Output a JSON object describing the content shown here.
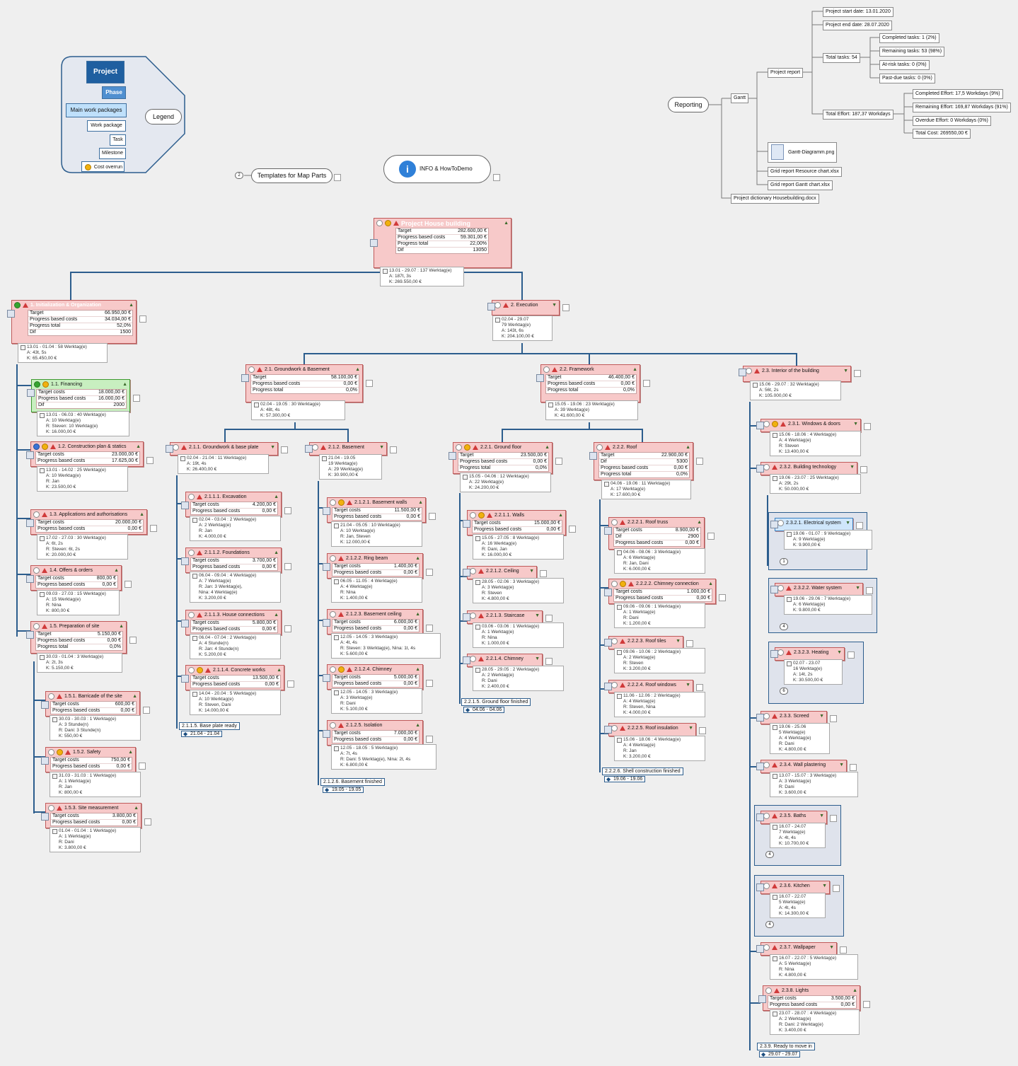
{
  "legend": {
    "title": "Legend",
    "items": [
      "Project",
      "Phase",
      "Main work packages",
      "Work package",
      "Task",
      "Milestone",
      "Cost overrun"
    ]
  },
  "templates": {
    "label": "Templates for Map Parts",
    "badge": "2"
  },
  "info": {
    "label": "INFO & HowToDemo"
  },
  "reporting": {
    "root": "Reporting",
    "gantt": "Gantt",
    "project_report": "Project report",
    "start": "Project start date: 13.01.2020",
    "end": "Project end date: 28.07.2020",
    "total_tasks": "Total tasks: 54",
    "completed": "Completed tasks: 1 (2%)",
    "remaining": "Remaining tasks: 53 (98%)",
    "at_risk": "At-risk tasks: 0 (0%)",
    "past_due": "Past-due tasks: 0 (0%)",
    "total_effort": "Total Effort: 187,37 Workdays",
    "completed_effort": "Completed Effort: 17,5 Workdays (9%)",
    "remaining_effort": "Remaining Effort: 169,87 Workdays (91%)",
    "overdue_effort": "Overdue Effort: 0 Workdays (0%)",
    "total_cost": "Total Cost: 269550,00 €",
    "gantt_png": "Gantt-Diagramm.png",
    "grid_resource": "Grid report Resource chart.xlsx",
    "grid_gantt": "Grid report Gantt chart.xlsx",
    "dictionary": "Project dictionary Housebuilding.docx"
  },
  "root": {
    "title": "Project House building",
    "rows": [
      [
        "Target",
        "282.600,00 €"
      ],
      [
        "Progress based costs",
        "59.301,00 €"
      ],
      [
        "Progress total",
        "22,00%"
      ],
      [
        "Dif",
        "13050"
      ]
    ],
    "info": [
      "13.01 - 29.07 : 137 Werktag(e)",
      "A: 187t, 3s",
      "K: 269.550,00 €"
    ]
  },
  "p1": {
    "title": "1. Initialization & Organization",
    "rows": [
      [
        "Target",
        "66.950,00 €"
      ],
      [
        "Progress based costs",
        "34.034,00 €"
      ],
      [
        "Progress total",
        "52,0%"
      ],
      [
        "Dif",
        "1500"
      ]
    ],
    "info": [
      "13.01 - 01.04 : 58 Werktag(e)",
      "A: 43t, 5s",
      "K: 65.450,00 €"
    ]
  },
  "p2": {
    "title": "2. Execution",
    "info": [
      "02.04 - 29.07",
      "79 Werktag(e)",
      "A: 143t, 6s",
      "K: 204.100,00 €"
    ]
  },
  "t11": {
    "title": "1.1. Financing",
    "rows": [
      [
        "Target costs",
        "18.000,00 €"
      ],
      [
        "Progress based costs",
        "16.000,00 €"
      ],
      [
        "Dif",
        "2000"
      ]
    ],
    "info": [
      "13.01 - 06.03 : 40 Werktag(e)",
      "A: 10 Werktag(e)",
      "R: Steven: 10 Werktag(e)",
      "K: 16.000,00 €"
    ]
  },
  "t12": {
    "title": "1.2. Construction plan & statics",
    "rows": [
      [
        "Target costs",
        "23.000,00 €"
      ],
      [
        "Progress based costs",
        "17.625,00 €"
      ]
    ],
    "info": [
      "13.01 - 14.02 : 25 Werktag(e)",
      "A: 10 Werktag(e)",
      "R: Jan",
      "K: 23.500,00 €"
    ]
  },
  "t13": {
    "title": "1.3. Applications and authorisations",
    "rows": [
      [
        "Target costs",
        "20.000,00 €"
      ],
      [
        "Progress based costs",
        "0,00 €"
      ]
    ],
    "info": [
      "17.02 - 27.03 : 30 Werktag(e)",
      "A: 6t, 2s",
      "R: Steven: 6t, 2s",
      "K: 20.000,00 €"
    ]
  },
  "t14": {
    "title": "1.4. Offers & orders",
    "rows": [
      [
        "Target costs",
        "800,00 €"
      ],
      [
        "Progress based costs",
        "0,00 €"
      ]
    ],
    "info": [
      "09.03 - 27.03 : 15 Werktag(e)",
      "A: 15 Werktag(e)",
      "R: Nina",
      "K: 800,00 €"
    ]
  },
  "t15": {
    "title": "1.5. Preparation of site",
    "rows": [
      [
        "Target",
        "5.150,00 €"
      ],
      [
        "Progress based costs",
        "0,00 €"
      ],
      [
        "Progress total",
        "0,0%"
      ]
    ],
    "info": [
      "30.03 - 01.04 : 3 Werktag(e)",
      "A: 2t, 3s",
      "K: 5.150,00 €"
    ]
  },
  "t151": {
    "title": "1.5.1. Barricade of the site",
    "rows": [
      [
        "Target costs",
        "600,00 €"
      ],
      [
        "Progress based costs",
        "0,00 €"
      ]
    ],
    "info": [
      "30.03 - 30.03 : 1 Werktag(e)",
      "A: 3 Stunde(n)",
      "R: Dani: 3 Stunde(n)",
      "K: 550,00 €"
    ]
  },
  "t152": {
    "title": "1.5.2. Safety",
    "rows": [
      [
        "Target costs",
        "750,00 €"
      ],
      [
        "Progress based costs",
        "0,00 €"
      ]
    ],
    "info": [
      "31.03 - 31.03 : 1 Werktag(e)",
      "A: 1 Werktag(e)",
      "R: Jan",
      "K: 800,00 €"
    ]
  },
  "t153": {
    "title": "1.5.3. Site measurement",
    "rows": [
      [
        "Target costs",
        "3.800,00 €"
      ],
      [
        "Progress based costs",
        "0,00 €"
      ]
    ],
    "info": [
      "01.04 - 01.04 : 1 Werktag(e)",
      "A: 1 Werktag(e)",
      "R: Dani",
      "K: 3.800,00 €"
    ]
  },
  "w21": {
    "title": "2.1. Groundwork & Basement",
    "rows": [
      [
        "Target",
        "58.100,00 €"
      ],
      [
        "Progress based costs",
        "0,00 €"
      ],
      [
        "Progress total",
        "0,0%"
      ]
    ],
    "info": [
      "02.04 - 19.05 : 30 Werktag(e)",
      "A: 48t, 4s",
      "K: 57.300,00 €"
    ]
  },
  "w22": {
    "title": "2.2. Framework",
    "rows": [
      [
        "Target",
        "46.400,00 €"
      ],
      [
        "Progress based costs",
        "0,00 €"
      ],
      [
        "Progress total",
        "0,0%"
      ]
    ],
    "info": [
      "15.05 - 19.06 : 23 Werktag(e)",
      "A: 39 Werktag(e)",
      "K: 41.600,00 €"
    ]
  },
  "w23": {
    "title": "2.3. Interior of the building",
    "info": [
      "15.06 - 29.07 : 32 Werktag(e)",
      "A: 56t, 2s",
      "K: 105.000,00 €"
    ]
  },
  "w211": {
    "title": "2.1.1. Groundwork & base plate",
    "info": [
      "02.04 - 21.04 : 11 Werktag(e)",
      "A: 19t, 4s",
      "K: 26.400,00 €"
    ]
  },
  "w212": {
    "title": "2.1.2. Basement",
    "info": [
      "21.04 - 19.05",
      "19 Werktag(e)",
      "A: 29 Werktag(e)",
      "K: 30.900,00 €"
    ]
  },
  "w221": {
    "title": "2.2.1. Ground floor",
    "rows": [
      [
        "Target",
        "23.500,00 €"
      ],
      [
        "Progress based costs",
        "0,00 €"
      ],
      [
        "Progress total",
        "0,0%"
      ]
    ],
    "info": [
      "15.05 - 04.06 : 12 Werktag(e)",
      "A: 22 Werktag(e)",
      "K: 24.200,00 €"
    ]
  },
  "w222": {
    "title": "2.2.2. Roof",
    "rows": [
      [
        "Target",
        "22.900,00 €"
      ],
      [
        "Dif",
        "5300"
      ],
      [
        "Progress based costs",
        "0,00 €"
      ],
      [
        "Progress total",
        "0,0%"
      ]
    ],
    "info": [
      "04.06 - 19.06 : 11 Werktag(e)",
      "A: 17 Werktag(e)",
      "K: 17.600,00 €"
    ]
  },
  "t2111": {
    "title": "2.1.1.1. Excavation",
    "rows": [
      [
        "Target costs",
        "4.200,00 €"
      ],
      [
        "Progress based costs",
        "0,00 €"
      ]
    ],
    "info": [
      "02.04 - 03.04 : 2 Werktag(e)",
      "A: 2 Werktag(e)",
      "R: Jan",
      "K: 4.000,00 €"
    ]
  },
  "t2112": {
    "title": "2.1.1.2. Foundations",
    "rows": [
      [
        "Target costs",
        "3.700,00 €"
      ],
      [
        "Progress based costs",
        "0,00 €"
      ]
    ],
    "info": [
      "06.04 - 09.04 : 4 Werktag(e)",
      "A: 7 Werktag(e)",
      "R: Jan: 3 Werktag(e),",
      "Nina: 4 Werktag(e)",
      "K: 3.200,00 €"
    ]
  },
  "t2113": {
    "title": "2.1.1.3. House connections",
    "rows": [
      [
        "Target costs",
        "5.800,00 €"
      ],
      [
        "Progress based costs",
        "0,00 €"
      ]
    ],
    "info": [
      "06.04 - 07.04 : 2 Werktag(e)",
      "A: 4 Stunde(n)",
      "R: Jan: 4 Stunde(n)",
      "K: 5.200,00 €"
    ]
  },
  "t2114": {
    "title": "2.1.1.4. Concrete works",
    "rows": [
      [
        "Target costs",
        "13.500,00 €"
      ],
      [
        "Progress based costs",
        "0,00 €"
      ]
    ],
    "info": [
      "14.04 - 20.04 : 5 Werktag(e)",
      "A: 10 Werktag(e)",
      "R: Steven, Dani",
      "K: 14.000,00 €"
    ]
  },
  "m2115": {
    "title": "2.1.1.5. Base plate ready",
    "date": "21.04 - 21.04"
  },
  "t2121": {
    "title": "2.1.2.1. Basement walls",
    "rows": [
      [
        "Target costs",
        "11.500,00 €"
      ],
      [
        "Progress based costs",
        "0,00 €"
      ]
    ],
    "info": [
      "21.04 - 05.05 : 10 Werktag(e)",
      "A: 10 Werktag(e)",
      "R: Jan, Steven",
      "K: 12.000,00 €"
    ]
  },
  "t2122": {
    "title": "2.1.2.2. Ring beam",
    "rows": [
      [
        "Target costs",
        "1.400,00 €"
      ],
      [
        "Progress based costs",
        "0,00 €"
      ]
    ],
    "info": [
      "06.05 - 11.05 : 4 Werktag(e)",
      "A: 4 Werktag(e)",
      "R: Nina",
      "K: 1.400,00 €"
    ]
  },
  "t2123": {
    "title": "2.1.2.3. Basement ceiling",
    "rows": [
      [
        "Target costs",
        "6.000,00 €"
      ],
      [
        "Progress based costs",
        "0,00 €"
      ]
    ],
    "info": [
      "12.05 - 14.05 : 3 Werktag(e)",
      "A: 4t, 4s",
      "R: Steven: 3 Werktag(e), Nina: 1t, 4s",
      "K: 5.600,00 €"
    ]
  },
  "t2124": {
    "title": "2.1.2.4. Chimney",
    "rows": [
      [
        "Target costs",
        "5.000,00 €"
      ],
      [
        "Progress based costs",
        "0,00 €"
      ]
    ],
    "info": [
      "12.05 - 14.05 : 3 Werktag(e)",
      "A: 3 Werktag(e)",
      "R: Dani",
      "K: 5.100,00 €"
    ]
  },
  "t2125": {
    "title": "2.1.2.5. Isolation",
    "rows": [
      [
        "Target costs",
        "7.000,00 €"
      ],
      [
        "Progress based costs",
        "0,00 €"
      ]
    ],
    "info": [
      "12.05 - 18.05 : 5 Werktag(e)",
      "A: 7t, 4s",
      "R: Dani: 5 Werktag(e), Nina: 2t, 4s",
      "K: 6.800,00 €"
    ]
  },
  "m2126": {
    "title": "2.1.2.6. Basement finished",
    "date": "19.05 - 19.05"
  },
  "t2211": {
    "title": "2.2.1.1. Walls",
    "rows": [
      [
        "Target costs",
        "15.000,00 €"
      ],
      [
        "Progress based costs",
        "0,00 €"
      ]
    ],
    "info": [
      "15.05 - 27.05 : 8 Werktag(e)",
      "A: 16 Werktag(e)",
      "R: Dani, Jan",
      "K: 16.000,00 €"
    ]
  },
  "t2212": {
    "title": "2.2.1.2. Ceiling",
    "info": [
      "28.05 - 02.06 : 3 Werktag(e)",
      "A: 3 Werktag(e)",
      "R: Steven",
      "K: 4.800,00 €"
    ]
  },
  "t2213": {
    "title": "2.2.1.3. Staircase",
    "info": [
      "03.06 - 03.06 : 1 Werktag(e)",
      "A: 1 Werktag(e)",
      "R: Nina",
      "K: 1.000,00 €"
    ]
  },
  "t2214": {
    "title": "2.2.1.4. Chimney",
    "info": [
      "28.05 - 29.05 : 2 Werktag(e)",
      "A: 2 Werktag(e)",
      "R: Dani",
      "K: 2.400,00 €"
    ]
  },
  "m2215": {
    "title": "2.2.1.5. Ground floor finished",
    "date": "04.06 - 04.06"
  },
  "t2221": {
    "title": "2.2.2.1. Roof truss",
    "rows": [
      [
        "Target costs",
        "8.900,00 €"
      ],
      [
        "Dif",
        "2900"
      ],
      [
        "Progress based costs",
        "0,00 €"
      ]
    ],
    "info": [
      "04.06 - 08.06 : 3 Werktag(e)",
      "A: 6 Werktag(e)",
      "R: Jan, Dani",
      "K: 6.000,00 €"
    ]
  },
  "t2222": {
    "title": "2.2.2.2. Chimney connection",
    "rows": [
      [
        "Target costs",
        "1.000,00 €"
      ],
      [
        "Progress based costs",
        "0,00 €"
      ]
    ],
    "info": [
      "09.06 - 09.06 : 1 Werktag(e)",
      "A: 1 Werktag(e)",
      "R: Dani",
      "K: 1.200,00 €"
    ]
  },
  "t2223": {
    "title": "2.2.2.3. Roof tiles",
    "info": [
      "09.06 - 10.06 : 2 Werktag(e)",
      "A: 2 Werktag(e)",
      "R: Steven",
      "K: 3.200,00 €"
    ]
  },
  "t2224": {
    "title": "2.2.2.4. Roof windows",
    "info": [
      "11.06 - 12.06 : 2 Werktag(e)",
      "A: 4 Werktag(e)",
      "R: Steven, Nina",
      "K: 4.000,00 €"
    ]
  },
  "t2225": {
    "title": "2.2.2.5. Roof insulation",
    "info": [
      "15.06 - 18.06 : 4 Werktag(e)",
      "A: 4 Werktag(e)",
      "R: Jan",
      "K: 3.200,00 €"
    ]
  },
  "m2226": {
    "title": "2.2.2.6. Shell construction finished",
    "date": "19.06 - 19.06"
  },
  "t231": {
    "title": "2.3.1. Windows & doors",
    "info": [
      "15.06 - 18.06 : 4 Werktag(e)",
      "A: 4 Werktag(e)",
      "R: Steven",
      "K: 13.400,00 €"
    ]
  },
  "t232": {
    "title": "2.3.2. Building technology",
    "info": [
      "19.06 - 23.07 : 25 Werktag(e)",
      "A: 29t, 2s",
      "K: 50.000,00 €"
    ]
  },
  "t2321": {
    "title": "2.3.2.1. Electrical system",
    "info": [
      "19.06 - 01.07 : 9 Werktag(e)",
      "A: 9 Werktag(e)",
      "K: 9.900,00 €"
    ],
    "badge": "1"
  },
  "t2322": {
    "title": "2.3.2.2. Water system",
    "info": [
      "19.06 - 29.06 : 7 Werktag(e)",
      "A: 6 Werktag(e)",
      "K: 9.800,00 €"
    ],
    "badge": "4"
  },
  "t2323": {
    "title": "2.3.2.3. Heating",
    "info": [
      "02.07 - 23.07",
      "16 Werktag(e)",
      "A: 14t, 2s",
      "K: 30.500,00 €"
    ],
    "badge": "6"
  },
  "t233": {
    "title": "2.3.3. Screed",
    "info": [
      "19.06 - 25.06",
      "5 Werktag(e)",
      "A: 4 Werktag(e)",
      "R: Dani",
      "K: 4.800,00 €"
    ]
  },
  "t234": {
    "title": "2.3.4. Wall plastering",
    "info": [
      "13.07 - 15.07 : 3 Werktag(e)",
      "A: 3 Werktag(e)",
      "R: Dani",
      "K: 3.600,00 €"
    ]
  },
  "t235": {
    "title": "2.3.5. Baths",
    "info": [
      "16.07 - 24.07",
      "7 Werktag(e)",
      "A: 4t, 4s",
      "K: 10.700,00 €"
    ],
    "badge": "4"
  },
  "t236": {
    "title": "2.3.6. Kitchen",
    "info": [
      "16.07 - 22.07",
      "5 Werktag(e)",
      "A: 4t, 4s",
      "K: 14.300,00 €"
    ],
    "badge": "4"
  },
  "t237": {
    "title": "2.3.7. Wallpaper",
    "info": [
      "16.07 - 22.07 : 5 Werktag(e)",
      "A: 5 Werktag(e)",
      "R: Nina",
      "K: 4.800,00 €"
    ]
  },
  "t238": {
    "title": "2.3.8. Lights",
    "rows": [
      [
        "Target costs",
        "3.500,00 €"
      ],
      [
        "Progress based costs",
        "0,00 €"
      ]
    ],
    "info": [
      "23.07 - 28.07 : 4 Werktag(e)",
      "A: 2 Werktag(e)",
      "R: Dani: 2 Werktag(e)",
      "K: 3.400,00 €"
    ]
  },
  "m239": {
    "title": "2.3.9. Ready to move in",
    "date": "29.07 - 29.07"
  }
}
